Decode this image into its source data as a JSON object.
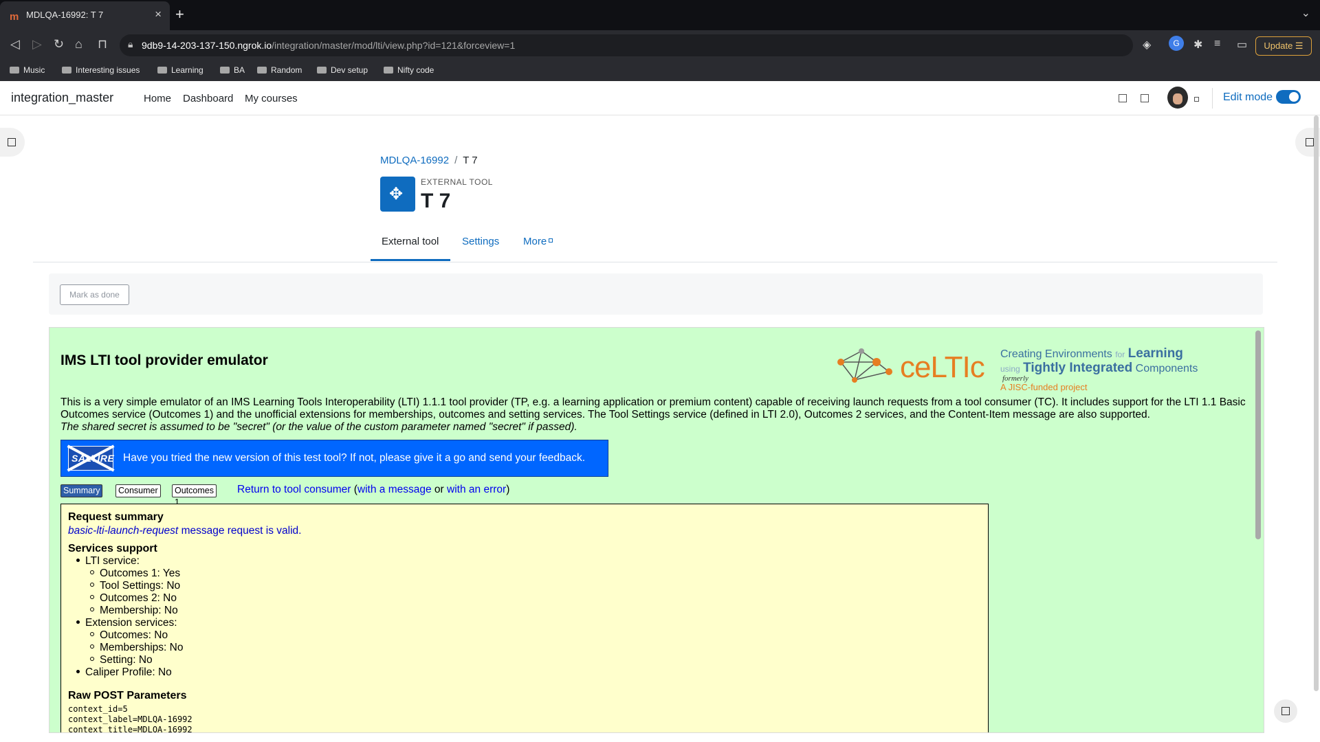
{
  "browser": {
    "tab_title": "MDLQA-16992: T 7",
    "tab_favicon_text": "m",
    "url_host": "9db9-14-203-137-150.ngrok.io",
    "url_path": "/integration/master/mod/lti/view.php?id=121&forceview=1",
    "update_label": "Update",
    "bookmarks": [
      "Music",
      "Interesting issues",
      "Learning",
      "BA",
      "Random",
      "Dev setup",
      "Nifty code"
    ]
  },
  "moodle": {
    "site_name": "integration_master",
    "primary_nav": [
      "Home",
      "Dashboard",
      "My courses"
    ],
    "edit_mode_label": "Edit mode",
    "edit_mode_on": true,
    "breadcrumb": {
      "course": "MDLQA-16992",
      "separator": "/",
      "current": "T 7"
    },
    "module_type": "EXTERNAL TOOL",
    "module_title": "T 7",
    "secondary_nav": {
      "tab1": "External tool",
      "tab2": "Settings",
      "tab3": "More"
    },
    "mark_as_done": "Mark as done"
  },
  "lti": {
    "title": "IMS LTI tool provider emulator",
    "description": "This is a very simple emulator of an IMS Learning Tools Interoperability (LTI) 1.1.1 tool provider (TP, e.g. a learning application or premium content) capable of receiving launch requests from a tool consumer (TC). It includes support for the LTI 1.1 Basic Outcomes service (Outcomes 1) and the unofficial extensions for memberships, outcomes and setting services. The Tool Settings service (defined in LTI 2.0), Outcomes 2 services, and the Content-Item message are also supported.",
    "secret_note": "The shared secret is assumed to be \"secret\" (or the value of the custom parameter named \"secret\" if passed).",
    "logo": {
      "wordmark": "ceLTIc",
      "line1a": "Creating Environments",
      "line1b": "for",
      "line1c": "Learning",
      "line2a": "using",
      "line2b": "Tightly Integrated",
      "line2c": "Components",
      "formerly": "formerly",
      "jisc": "A JISC-funded project"
    },
    "saltire": {
      "flag_label": "SALTIRE",
      "message": "Have you tried the new version of this test tool? If not, please give it a go and send your feedback."
    },
    "tabs": {
      "summary": "Summary",
      "consumer": "Consumer",
      "outcomes": "Outcomes 1"
    },
    "return_link": "Return to tool consumer",
    "open_paren": "(",
    "with_message": "with a message",
    "or_text": "or",
    "with_error": "with an error",
    "close_paren": ")",
    "summary": {
      "heading": "Request summary",
      "message_type": "basic-lti-launch-request",
      "valid_text": "message request is valid.",
      "services_heading": "Services support",
      "lti_service": "LTI service:",
      "outcomes1": "Outcomes 1: Yes",
      "tool_settings": "Tool Settings: No",
      "outcomes2": "Outcomes 2: No",
      "membership": "Membership: No",
      "extension_services": "Extension services:",
      "ext_outcomes": "Outcomes: No",
      "ext_memberships": "Memberships: No",
      "ext_setting": "Setting: No",
      "caliper": "Caliper Profile: No",
      "raw_heading": "Raw POST Parameters",
      "raw_params": [
        "context_id=5",
        "context_label=MDLQA-16992",
        "context_title=MDLQA-16992"
      ]
    }
  }
}
